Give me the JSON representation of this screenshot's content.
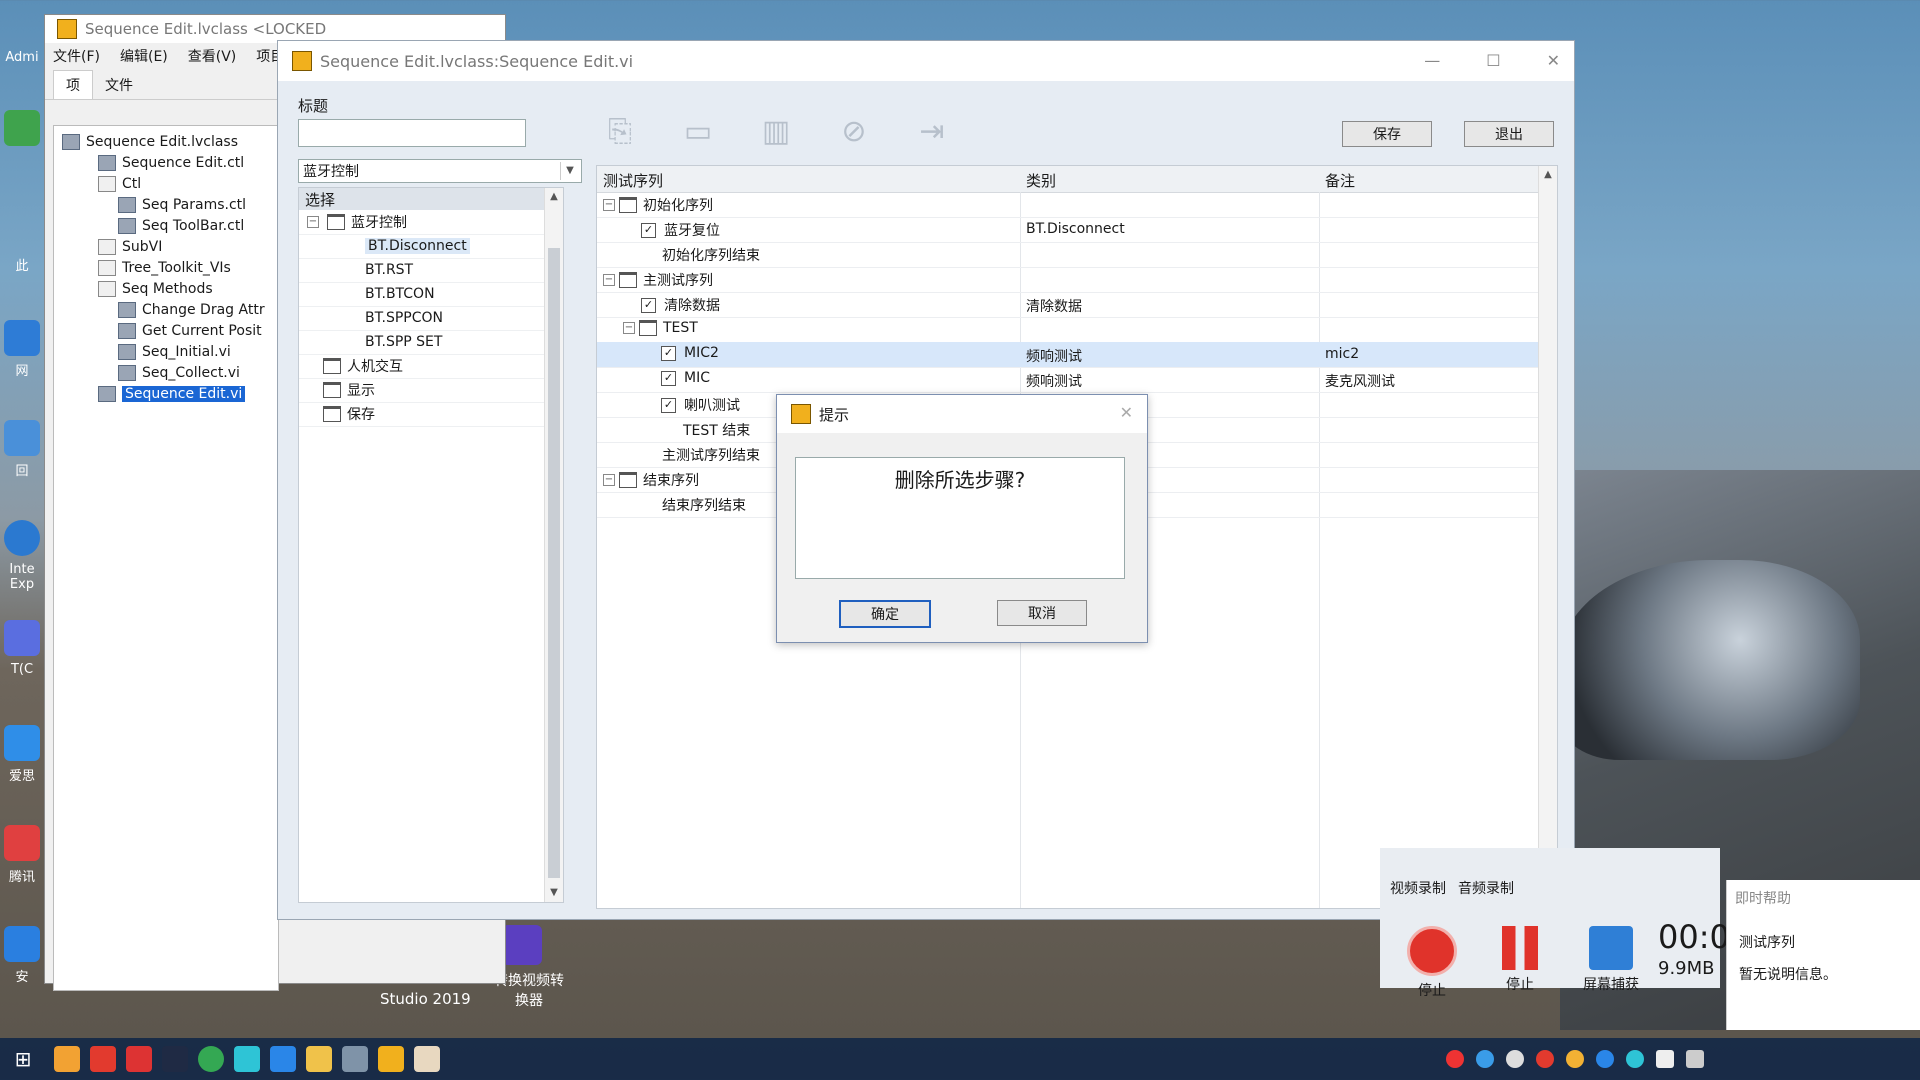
{
  "desktop": {
    "icon_labels": [
      "Admi",
      "此",
      "网",
      "回",
      "Inte Exp",
      "T(C",
      "爱思",
      "腾讯",
      "安"
    ],
    "studio_label": "Studio 2019",
    "converter_label": "转换视频转换器"
  },
  "project_window": {
    "title": "Sequence Edit.lvclass <LOCKED",
    "menu": [
      "文件(F)",
      "编辑(E)",
      "查看(V)",
      "项目"
    ],
    "tabs": [
      "项",
      "文件"
    ],
    "tree": [
      "Sequence Edit.lvclass",
      "Sequence Edit.ctl",
      "Ctl",
      "Seq Params.ctl",
      "Seq ToolBar.ctl",
      "SubVI",
      "Tree_Toolkit_VIs",
      "Seq Methods",
      "Change Drag Attr",
      "Get Current Posit",
      "Seq_Initial.vi",
      "Seq_Collect.vi",
      "Sequence Edit.vi"
    ]
  },
  "main_window": {
    "title": "Sequence Edit.lvclass:Sequence Edit.vi",
    "title_label": "标题",
    "title_value": "",
    "save_button": "保存",
    "exit_button": "退出",
    "toolbar_icons": [
      "new-step-icon",
      "new-folder-icon",
      "delete-icon",
      "disable-icon",
      "export-icon"
    ],
    "category_select": "蓝牙控制",
    "left_tree_header": "选择",
    "left_tree": [
      {
        "label": "蓝牙控制",
        "type": "folder",
        "expanded": true
      },
      {
        "label": "BT.Disconnect",
        "type": "item",
        "selected": true
      },
      {
        "label": "BT.RST",
        "type": "item"
      },
      {
        "label": "BT.BTCON",
        "type": "item"
      },
      {
        "label": "BT.SPPCON",
        "type": "item"
      },
      {
        "label": "BT.SPP SET",
        "type": "item"
      },
      {
        "label": "人机交互",
        "type": "folder"
      },
      {
        "label": "显示",
        "type": "folder"
      },
      {
        "label": "保存",
        "type": "folder"
      }
    ],
    "grid_headers": [
      "测试序列",
      "类别",
      "备注"
    ],
    "grid_rows": [
      {
        "label": "初始化序列",
        "kind": "group",
        "category": "",
        "note": ""
      },
      {
        "label": "蓝牙复位",
        "kind": "check",
        "category": "BT.Disconnect",
        "note": ""
      },
      {
        "label": "初始化序列结束",
        "kind": "end",
        "category": "",
        "note": ""
      },
      {
        "label": "主测试序列",
        "kind": "group",
        "category": "",
        "note": ""
      },
      {
        "label": "清除数据",
        "kind": "check",
        "category": "清除数据",
        "note": ""
      },
      {
        "label": "TEST",
        "kind": "subgroup",
        "category": "",
        "note": ""
      },
      {
        "label": "MIC2",
        "kind": "check2",
        "category": "频响测试",
        "note": "mic2",
        "highlight": true
      },
      {
        "label": "MIC",
        "kind": "check2",
        "category": "频响测试",
        "note": "麦克风测试"
      },
      {
        "label": "喇叭测试",
        "kind": "check2",
        "category": "",
        "note": ""
      },
      {
        "label": "TEST 结束",
        "kind": "end2",
        "category": "",
        "note": ""
      },
      {
        "label": "主测试序列结束",
        "kind": "end",
        "category": "",
        "note": ""
      },
      {
        "label": "结束序列",
        "kind": "group",
        "category": "",
        "note": ""
      },
      {
        "label": "结束序列结束",
        "kind": "end",
        "category": "",
        "note": ""
      }
    ]
  },
  "dialog": {
    "title": "提示",
    "message": "删除所选步骤?",
    "ok": "确定",
    "cancel": "取消"
  },
  "recorder": {
    "tabs": [
      "视频录制",
      "音频录制"
    ],
    "stop": "停止",
    "pause": "停止",
    "capture": "屏幕捕获",
    "time": "00:0",
    "size": "9.9MB"
  },
  "help_panel": {
    "title": "即时帮助",
    "heading": "测试序列",
    "text": "暂无说明信息。"
  }
}
